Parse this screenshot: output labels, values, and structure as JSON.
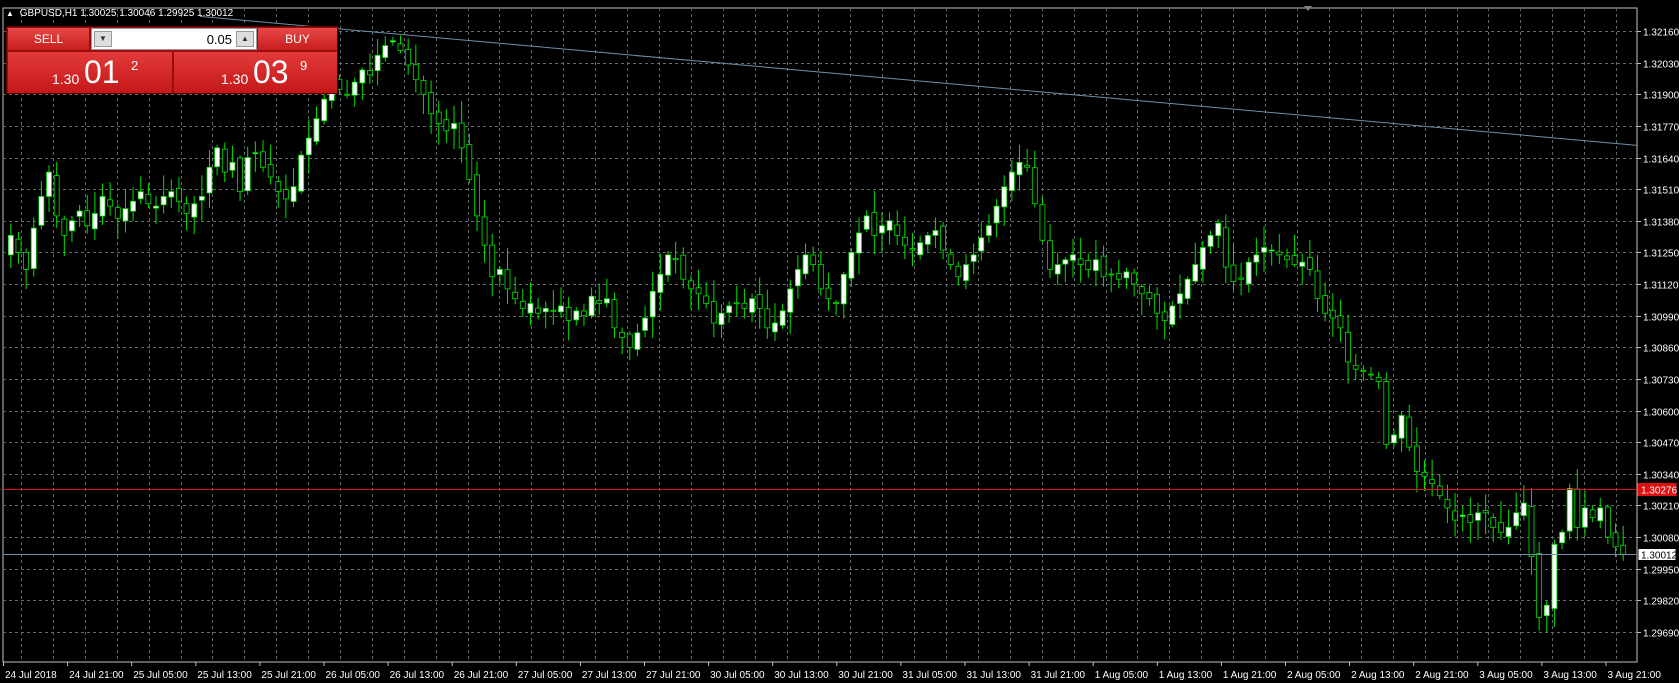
{
  "header": {
    "symbol": "GBPUSD,H1",
    "ohlc": "1.30025 1.30046 1.29925 1.30012"
  },
  "trade_panel": {
    "sell_label": "SELL",
    "buy_label": "BUY",
    "lot_value": "0.05",
    "sell_price": {
      "small": "1.30",
      "big": "01",
      "sup": "2"
    },
    "buy_price": {
      "small": "1.30",
      "big": "03",
      "sup": "9"
    }
  },
  "colors": {
    "background": "#000000",
    "grid": "#5f6a6a",
    "candle_up": "#ffffff",
    "candle_down": "#000000",
    "wick": "#00e000",
    "trendline": "#6e8ea9",
    "hline_red": "#e01010",
    "hline_blue": "#6e8ea9",
    "red_tag": "#e01010"
  },
  "chart_data": {
    "type": "candlestick",
    "title": "GBPUSD,H1",
    "y_ticks": [
      "1.32160",
      "1.32030",
      "1.31900",
      "1.31770",
      "1.31640",
      "1.31510",
      "1.31380",
      "1.31250",
      "1.31120",
      "1.30990",
      "1.30860",
      "1.30730",
      "1.30600",
      "1.30470",
      "1.30340",
      "1.30210",
      "1.30080",
      "1.29950",
      "1.29820",
      "1.29690"
    ],
    "ylim": [
      1.2969,
      1.3216
    ],
    "x_labels": [
      "24 Jul 2018",
      "24 Jul 21:00",
      "25 Jul 05:00",
      "25 Jul 13:00",
      "25 Jul 21:00",
      "26 Jul 05:00",
      "26 Jul 13:00",
      "26 Jul 21:00",
      "27 Jul 05:00",
      "27 Jul 13:00",
      "27 Jul 21:00",
      "30 Jul 05:00",
      "30 Jul 13:00",
      "30 Jul 21:00",
      "31 Jul 05:00",
      "31 Jul 13:00",
      "31 Jul 21:00",
      "1 Aug 05:00",
      "1 Aug 13:00",
      "1 Aug 21:00",
      "2 Aug 05:00",
      "2 Aug 13:00",
      "2 Aug 21:00",
      "3 Aug 05:00",
      "3 Aug 13:00",
      "3 Aug 21:00"
    ],
    "grid": true,
    "price_lines": [
      {
        "name": "marker",
        "value": 1.30276,
        "label": "1.30276"
      },
      {
        "name": "bid",
        "value": 1.30012,
        "label": "1.30012"
      }
    ],
    "trendline": {
      "start": 1.3222,
      "end": 1.3169
    },
    "closes": [
      1.3132,
      1.3125,
      1.3118,
      1.3135,
      1.3148,
      1.3158,
      1.314,
      1.3132,
      1.3138,
      1.3142,
      1.3136,
      1.3141,
      1.3148,
      1.3144,
      1.3139,
      1.3143,
      1.3146,
      1.315,
      1.3145,
      1.3144,
      1.3148,
      1.315,
      1.3146,
      1.3141,
      1.3145,
      1.3148,
      1.316,
      1.3168,
      1.3158,
      1.3162,
      1.315,
      1.3164,
      1.3166,
      1.316,
      1.3156,
      1.315,
      1.3147,
      1.3152,
      1.3165,
      1.3172,
      1.318,
      1.3188,
      1.3195,
      1.3192,
      1.319,
      1.3195,
      1.32,
      1.3198,
      1.3206,
      1.321,
      1.3212,
      1.3208,
      1.3202,
      1.3196,
      1.319,
      1.3182,
      1.3178,
      1.3175,
      1.3178,
      1.3168,
      1.3155,
      1.314,
      1.3128,
      1.3115,
      1.3118,
      1.311,
      1.3106,
      1.3102,
      1.3104,
      1.31,
      1.3102,
      1.3101,
      1.3103,
      1.3097,
      1.3101,
      1.3099,
      1.3107,
      1.3104,
      1.3106,
      1.3094,
      1.309,
      1.3086,
      1.3092,
      1.3098,
      1.3109,
      1.3116,
      1.3124,
      1.3122,
      1.3114,
      1.311,
      1.3108,
      1.3104,
      1.3096,
      1.31,
      1.3103,
      1.3104,
      1.3102,
      1.3106,
      1.3102,
      1.3094,
      1.3096,
      1.3101,
      1.311,
      1.3118,
      1.3124,
      1.312,
      1.311,
      1.3106,
      1.3104,
      1.3116,
      1.3125,
      1.3133,
      1.314,
      1.3132,
      1.3136,
      1.3138,
      1.3132,
      1.3128,
      1.3126,
      1.3129,
      1.3132,
      1.3134,
      1.3126,
      1.312,
      1.3115,
      1.312,
      1.3124,
      1.3131,
      1.3136,
      1.3144,
      1.3152,
      1.3158,
      1.3162,
      1.316,
      1.3145,
      1.313,
      1.3118,
      1.312,
      1.3122,
      1.3124,
      1.312,
      1.3118,
      1.3122,
      1.3115,
      1.3116,
      1.3114,
      1.3117,
      1.3112,
      1.3108,
      1.3106,
      1.31,
      1.3097,
      1.3103,
      1.3108,
      1.3114,
      1.312,
      1.3127,
      1.3132,
      1.3137,
      1.3119,
      1.3113,
      1.3114,
      1.3121,
      1.3124,
      1.3127,
      1.3126,
      1.3124,
      1.3122,
      1.312,
      1.3121,
      1.3118,
      1.3106,
      1.31,
      1.3098,
      1.3094,
      1.308,
      1.3077,
      1.3076,
      1.3075,
      1.3072,
      1.3046,
      1.305,
      1.3058,
      1.3045,
      1.3035,
      1.3033,
      1.303,
      1.3025,
      1.302,
      1.3015,
      1.3017,
      1.3014,
      1.3018,
      1.3018,
      1.3012,
      1.301,
      1.3012,
      1.3018,
      1.3022,
      1.3,
      1.2975,
      1.298,
      1.3005,
      1.301,
      1.3028,
      1.3012,
      1.302,
      1.3016,
      1.302,
      1.3008,
      1.3004,
      1.3001
    ]
  }
}
